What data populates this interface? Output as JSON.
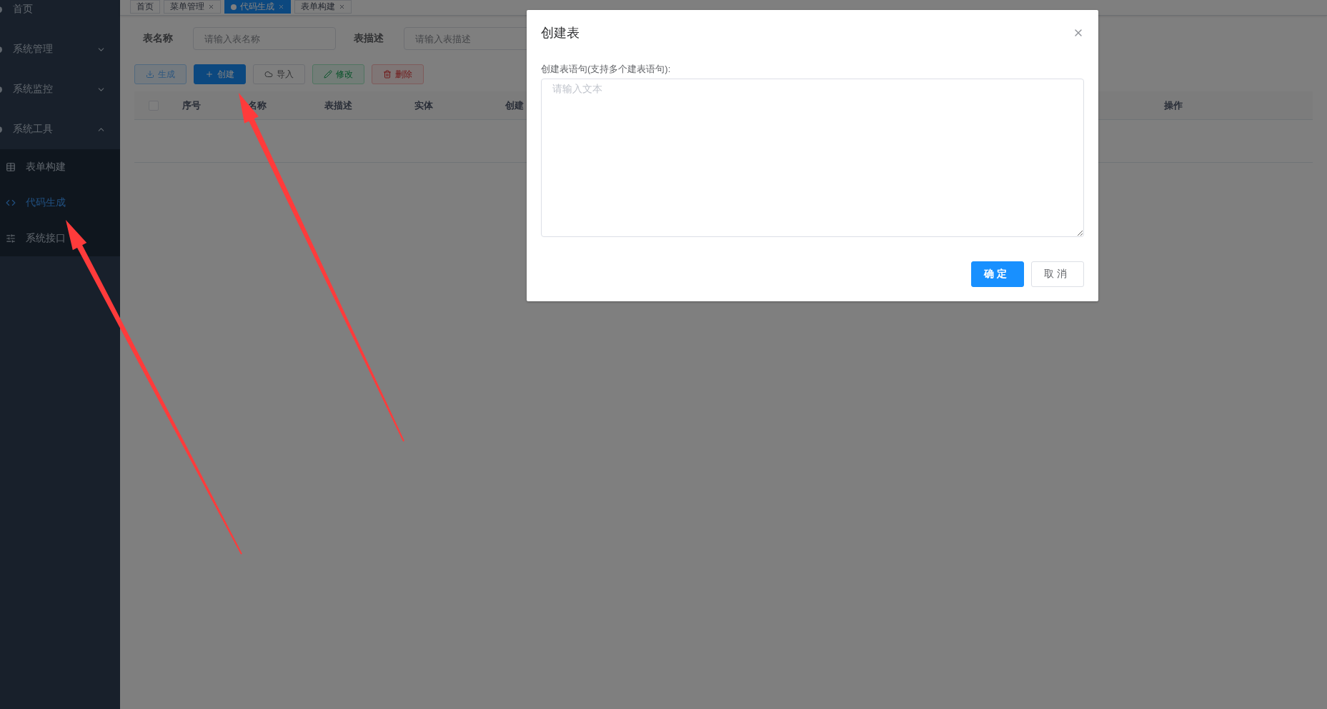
{
  "sidebar": {
    "items": [
      {
        "label": "首页",
        "kind": "link",
        "selected": false
      },
      {
        "label": "系统管理",
        "kind": "submenu",
        "selected": false,
        "expanded": false
      },
      {
        "label": "系统监控",
        "kind": "submenu",
        "selected": false,
        "expanded": false
      },
      {
        "label": "系统工具",
        "kind": "submenu",
        "selected": false,
        "expanded": true,
        "children": [
          {
            "label": "表单构建",
            "selected": false
          },
          {
            "label": "代码生成",
            "selected": true
          },
          {
            "label": "系统接口",
            "selected": false
          }
        ]
      }
    ]
  },
  "tags": [
    {
      "label": "首页",
      "selected": false,
      "closable": false
    },
    {
      "label": "菜单管理",
      "selected": false,
      "closable": true
    },
    {
      "label": "代码生成",
      "selected": true,
      "closable": true
    },
    {
      "label": "表单构建",
      "selected": false,
      "closable": true
    }
  ],
  "search": {
    "fields": [
      {
        "label": "表名称",
        "placeholder": "请输入表名称"
      },
      {
        "label": "表描述",
        "placeholder": "请输入表描述"
      }
    ]
  },
  "toolbar": [
    {
      "label": "生成",
      "kind": "primary",
      "disabled": true
    },
    {
      "label": "创建",
      "kind": "primary",
      "disabled": false
    },
    {
      "label": "导入",
      "kind": "default",
      "disabled": false
    },
    {
      "label": "修改",
      "kind": "success",
      "disabled": true
    },
    {
      "label": "删除",
      "kind": "danger",
      "disabled": true
    }
  ],
  "table": {
    "select_all": {
      "checked": false
    },
    "columns": [
      "序号",
      "名称",
      "表描述",
      "实体",
      "创建"
    ],
    "last_column": "操作"
  },
  "dialog": {
    "title": "创建表",
    "label": "创建表语句(支持多个建表语句):",
    "placeholder": "请输入文本",
    "buttons": [
      {
        "label": "确定",
        "kind": "primary"
      },
      {
        "label": "取消",
        "kind": "default"
      }
    ]
  }
}
